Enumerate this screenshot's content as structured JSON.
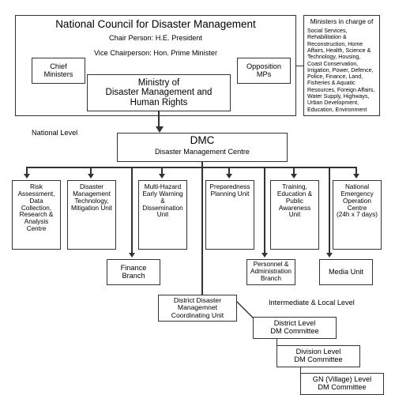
{
  "chart_data": {
    "type": "diagram",
    "title": "Disaster Management Organizational Structure"
  },
  "top": {
    "council_title": "National Council for Disaster Management",
    "chair": "Chair Person: H.E. President",
    "vice_chair": "Vice Chairperson: Hon. Prime Minister",
    "chief_ministers": "Chief\nMinisters",
    "chief_ministers_l1": "Chief",
    "chief_ministers_l2": "Ministers",
    "opposition_l1": "Opposition",
    "opposition_l2": "MPs",
    "ministry_l1": "Ministry of",
    "ministry_l2": "Disaster Management and",
    "ministry_l3": "Human Rights"
  },
  "ministers_panel": {
    "heading": "Ministers in charge of",
    "body": "Social Services, Rehabilitation & Reconstruction, Home Affairs, Health, Science & Technology, Housing, Coast Conservation, Irrigation, Power, Defence, Police, Finance, Land, Fisheries & Aquatic Resources, Foreign Affairs, Water Supply, Highways, Urban Development, Education, Environment"
  },
  "levels": {
    "national": "National Level",
    "intermediate": "Intermediate & Local Level"
  },
  "dmc": {
    "acronym": "DMC",
    "full_name": "Disaster Management Centre"
  },
  "units": [
    {
      "name": "risk-assessment-unit",
      "lines": [
        "Risk",
        "Assessment,",
        "Data",
        "Collection,",
        "Research &",
        "Analysis",
        "Centre"
      ]
    },
    {
      "name": "dm-technology-unit",
      "lines": [
        "Disaster",
        "Management",
        "Technology,",
        "Mitigation Unit"
      ]
    },
    {
      "name": "multi-hazard-unit",
      "lines": [
        "Multi-Hazard",
        "Early Warning",
        "&",
        "Dissemination",
        "Unit"
      ]
    },
    {
      "name": "preparedness-unit",
      "lines": [
        "Preparedness",
        "Planning Unit"
      ]
    },
    {
      "name": "training-education-unit",
      "lines": [
        "Training,",
        "Education &",
        "Public",
        "Awareness",
        "Unit"
      ]
    },
    {
      "name": "national-emergency-unit",
      "lines": [
        "National",
        "Emergency",
        "Operation",
        "Centre",
        "(24h x 7 days)"
      ]
    }
  ],
  "branches": {
    "finance_l1": "Finance",
    "finance_l2": "Branch",
    "personnel_l1": "Personnel &",
    "personnel_l2": "Administration",
    "personnel_l3": "Branch",
    "media": "Media Unit"
  },
  "district_unit": {
    "l1": "District Disaster",
    "l2": "Managemnet",
    "l3": "Coordinating Unit"
  },
  "committees": [
    {
      "name": "district-level-committee",
      "l1": "District Level",
      "l2": "DM Committee"
    },
    {
      "name": "division-level-committee",
      "l1": "Division Level",
      "l2": "DM Committee"
    },
    {
      "name": "gn-village-level-committee",
      "l1": "GN (Village) Level",
      "l2": "DM Committee"
    }
  ]
}
